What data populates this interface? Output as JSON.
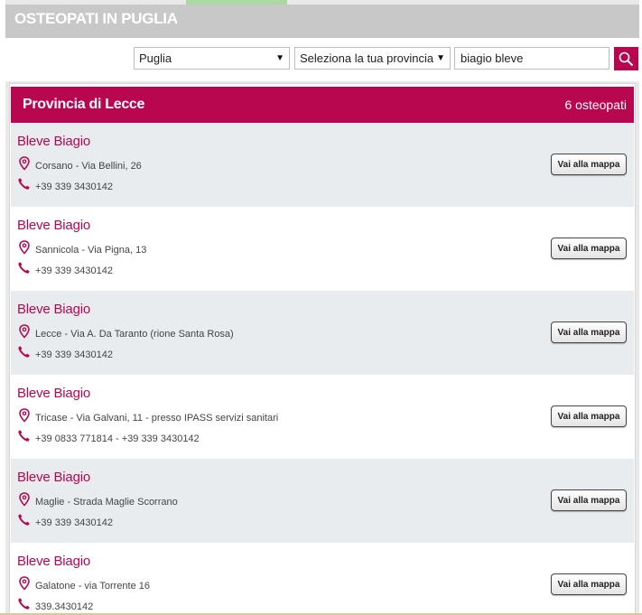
{
  "page": {
    "title": "OSTEOPATI IN PUGLIA"
  },
  "filters": {
    "region": "Puglia",
    "province": "Seleziona la tua provincia",
    "search_value": "biagio bleve"
  },
  "results": {
    "province_title": "Provincia di Lecce",
    "count_label": "6 osteopati",
    "map_button_label": "Vai alla mappa",
    "entries": [
      {
        "name": "Bleve Biagio",
        "address": "Corsano - Via Bellini, 26",
        "phone": "+39 339 3430142"
      },
      {
        "name": "Bleve Biagio",
        "address": "Sannicola - Via Pigna, 13",
        "phone": "+39 339 3430142"
      },
      {
        "name": "Bleve Biagio",
        "address": "Lecce - Via A. Da Taranto (rione Santa Rosa)",
        "phone": "+39 339 3430142"
      },
      {
        "name": "Bleve Biagio",
        "address": "Tricase - Via Galvani, 11 - presso IPASS servizi sanitari",
        "phone": "+39 0833 771814 - +39 339 3430142"
      },
      {
        "name": "Bleve Biagio",
        "address": "Maglie - Strada Maglie Scorrano",
        "phone": "+39 339 3430142"
      },
      {
        "name": "Bleve Biagio",
        "address": "Galatone - via Torrente 16",
        "phone": "339.3430142"
      }
    ]
  },
  "icons": {
    "location": "map-pin-icon",
    "phone": "phone-icon",
    "search": "search-icon",
    "dropdown": "dropdown-arrow-icon"
  },
  "colors": {
    "accent": "#b8064f",
    "alt_row": "#e8ecef",
    "title_bar": "#c8c8c8"
  }
}
